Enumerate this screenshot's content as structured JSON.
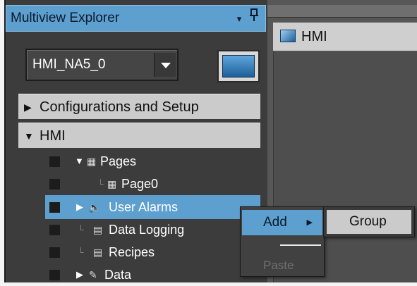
{
  "explorer": {
    "title": "Multiview Explorer",
    "menu_glyph": "▾",
    "pin_glyph": "ᴾ",
    "device_select": {
      "value": "HMI_NA5_0",
      "icon": "chevron-down-icon"
    },
    "device_icon": "hmi-device-icon",
    "sections": [
      {
        "label": "Configurations and Setup",
        "state": "collapsed"
      },
      {
        "label": "HMI",
        "state": "expanded"
      }
    ],
    "tree": [
      {
        "label": "Pages",
        "icon": "pages-icon",
        "state": "expanded"
      },
      {
        "label": "Page0",
        "icon": "page-icon",
        "state": "leaf"
      },
      {
        "label": "User Alarms",
        "icon": "speaker-icon",
        "state": "collapsed",
        "selected": true
      },
      {
        "label": "Data Logging",
        "icon": "data-logging-icon",
        "state": "leaf"
      },
      {
        "label": "Recipes",
        "icon": "recipes-icon",
        "state": "leaf"
      },
      {
        "label": "Data",
        "icon": "data-icon",
        "state": "collapsed"
      }
    ]
  },
  "document": {
    "tab_label": "HMI",
    "tab_icon": "hmi-screen-icon"
  },
  "context_menu": {
    "items": [
      {
        "label": "Add",
        "has_submenu": true,
        "highlighted": true
      },
      {
        "label": "Paste",
        "enabled": false
      }
    ],
    "submenu": {
      "items": [
        {
          "label": "Group"
        }
      ]
    }
  },
  "colors": {
    "highlight": "#5d9fce",
    "panel_bg": "#3c3c3c",
    "section_bg": "#cbcbcb",
    "disabled_text": "#6f6f6f"
  }
}
